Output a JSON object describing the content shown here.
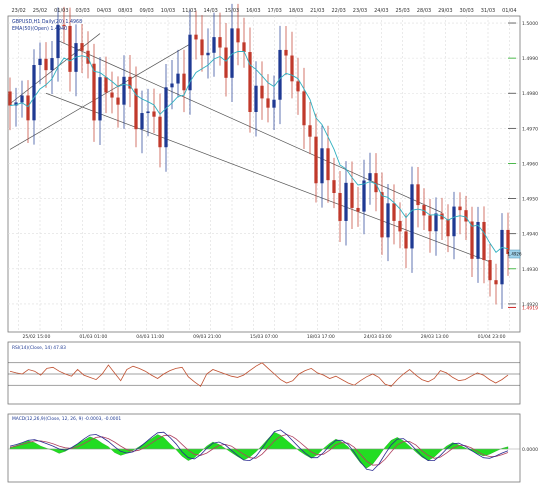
{
  "chart_data": [
    {
      "panel": "price",
      "type": "candlestick",
      "legend": [
        "GBPUSD,H1 Daily(20) 1.4968",
        "EMA(50)(Open) 1.4940"
      ],
      "top_dates": [
        "23/02",
        "25/02",
        "01/03",
        "03/03",
        "04/03",
        "08/03",
        "09/03",
        "10/03",
        "11/03",
        "14/03",
        "15/03",
        "16/03",
        "17/03",
        "18/03",
        "21/03",
        "22/03",
        "23/03",
        "24/03",
        "25/03",
        "28/03",
        "29/03",
        "30/03",
        "31/03",
        "01/04"
      ],
      "bottom_dates": [
        "25/02 15:00",
        "01/03 01:00",
        "04/03 11:00",
        "09/03 21:00",
        "15/03 07:00",
        "18/03 17:00",
        "24/03 03:00",
        "29/03 13:00",
        "01/04 23:00"
      ],
      "y_ticks": [
        1.5,
        1.499,
        1.498,
        1.497,
        1.496,
        1.495,
        1.494,
        1.493,
        1.492
      ],
      "ylim": [
        1.4912,
        1.5002
      ],
      "last_price_label": "1.4926",
      "marker_label": "1.4919",
      "series_path": [
        [
          0,
          1.4973
        ],
        [
          3,
          1.498
        ],
        [
          6,
          1.499
        ],
        [
          8,
          1.4996
        ],
        [
          10,
          1.4994
        ],
        [
          12,
          1.499
        ],
        [
          14,
          1.4981
        ],
        [
          16,
          1.4978
        ],
        [
          18,
          1.4982
        ],
        [
          20,
          1.4978
        ],
        [
          22,
          1.4974
        ],
        [
          24,
          1.497
        ],
        [
          26,
          1.4977
        ],
        [
          28,
          1.4985
        ],
        [
          30,
          1.4991
        ],
        [
          32,
          1.4995
        ],
        [
          34,
          1.4992
        ],
        [
          35,
          1.499
        ],
        [
          37,
          1.4995
        ],
        [
          39,
          1.499
        ],
        [
          41,
          1.4976
        ],
        [
          43,
          1.4978
        ],
        [
          45,
          1.4987
        ],
        [
          47,
          1.499
        ],
        [
          49,
          1.4968
        ],
        [
          51,
          1.4963
        ],
        [
          53,
          1.4954
        ],
        [
          55,
          1.495
        ],
        [
          57,
          1.4946
        ],
        [
          59,
          1.4956
        ],
        [
          61,
          1.495
        ],
        [
          63,
          1.4944
        ],
        [
          65,
          1.494
        ],
        [
          67,
          1.4947
        ],
        [
          69,
          1.4948
        ],
        [
          71,
          1.494
        ],
        [
          73,
          1.4946
        ],
        [
          75,
          1.4944
        ],
        [
          77,
          1.4941
        ],
        [
          79,
          1.4932
        ],
        [
          80,
          1.4928
        ],
        [
          82,
          1.4934
        ]
      ],
      "band_upper": [
        [
          0,
          1.4977
        ],
        [
          15,
          1.4997
        ]
      ],
      "channel_upper": [
        [
          8,
          1.4995
        ],
        [
          72,
          1.4946
        ]
      ],
      "channel_lower": [
        [
          0,
          1.4964
        ],
        [
          30,
          1.4994
        ]
      ],
      "channel_diag": [
        [
          6,
          1.498
        ],
        [
          80,
          1.4932
        ]
      ]
    },
    {
      "panel": "rsi",
      "type": "line",
      "legend": "RSI(14)(Close, 14) 47.83",
      "levels": [
        70,
        50,
        30
      ],
      "ylim": [
        0,
        100
      ],
      "values": [
        55,
        52,
        50,
        58,
        55,
        48,
        60,
        62,
        55,
        50,
        46,
        58,
        48,
        44,
        40,
        50,
        66,
        52,
        38,
        58,
        64,
        60,
        55,
        48,
        42,
        50,
        56,
        60,
        62,
        45,
        36,
        28,
        50,
        58,
        54,
        50,
        46,
        44,
        48,
        56,
        64,
        70,
        60,
        50,
        40,
        34,
        38,
        50,
        56,
        60,
        52,
        48,
        42,
        46,
        40,
        34,
        30,
        38,
        45,
        50,
        44,
        32,
        28,
        40,
        50,
        58,
        48,
        40,
        36,
        42,
        56,
        52,
        44,
        38,
        40,
        46,
        52,
        48,
        40,
        34,
        40,
        48
      ]
    },
    {
      "panel": "macd",
      "type": "histogram_line",
      "legend": "MACD(12,26,9)(Close, 12, 26, 9) -0.0003, -0.0001",
      "y_tick": "0.0000",
      "ylim": [
        -1,
        1
      ],
      "hist": [
        0.05,
        0.12,
        0.2,
        0.28,
        0.22,
        0.1,
        0.02,
        -0.05,
        -0.15,
        -0.08,
        0.04,
        0.18,
        0.3,
        0.42,
        0.34,
        0.2,
        0.08,
        -0.12,
        -0.22,
        -0.15,
        -0.05,
        0.08,
        0.22,
        0.36,
        0.5,
        0.4,
        0.18,
        -0.02,
        -0.25,
        -0.4,
        -0.3,
        -0.1,
        0.1,
        0.24,
        0.16,
        0.02,
        -0.12,
        -0.26,
        -0.38,
        -0.28,
        -0.1,
        0.12,
        0.36,
        0.58,
        0.48,
        0.3,
        0.12,
        -0.06,
        -0.2,
        -0.32,
        -0.2,
        0.02,
        0.2,
        0.34,
        0.24,
        0.08,
        -0.2,
        -0.48,
        -0.66,
        -0.52,
        -0.24,
        0.06,
        0.3,
        0.4,
        0.28,
        0.1,
        -0.1,
        -0.28,
        -0.4,
        -0.28,
        -0.08,
        0.1,
        0.22,
        0.14,
        0.04,
        -0.06,
        -0.16,
        -0.24,
        -0.18,
        -0.08,
        0.02,
        0.08
      ],
      "macd": [
        0.1,
        0.15,
        0.22,
        0.3,
        0.32,
        0.26,
        0.18,
        0.1,
        0.0,
        -0.04,
        0.05,
        0.18,
        0.34,
        0.48,
        0.5,
        0.4,
        0.26,
        0.08,
        -0.08,
        -0.14,
        -0.1,
        0.04,
        0.22,
        0.4,
        0.56,
        0.58,
        0.4,
        0.18,
        -0.1,
        -0.3,
        -0.34,
        -0.2,
        0.02,
        0.2,
        0.24,
        0.14,
        -0.04,
        -0.22,
        -0.38,
        -0.4,
        -0.26,
        0.02,
        0.32,
        0.6,
        0.66,
        0.5,
        0.28,
        0.06,
        -0.14,
        -0.3,
        -0.3,
        -0.12,
        0.12,
        0.3,
        0.3,
        0.16,
        -0.12,
        -0.44,
        -0.7,
        -0.74,
        -0.52,
        -0.18,
        0.14,
        0.34,
        0.36,
        0.2,
        -0.02,
        -0.24,
        -0.4,
        -0.4,
        -0.22,
        0.0,
        0.18,
        0.2,
        0.1,
        -0.04,
        -0.18,
        -0.3,
        -0.32,
        -0.24,
        -0.14,
        -0.06
      ],
      "signal": [
        0.06,
        0.1,
        0.16,
        0.22,
        0.28,
        0.28,
        0.24,
        0.18,
        0.1,
        0.04,
        0.02,
        0.08,
        0.18,
        0.3,
        0.4,
        0.42,
        0.36,
        0.24,
        0.1,
        -0.02,
        -0.08,
        -0.04,
        0.06,
        0.2,
        0.34,
        0.46,
        0.48,
        0.36,
        0.16,
        -0.04,
        -0.18,
        -0.22,
        -0.14,
        0.0,
        0.12,
        0.16,
        0.1,
        -0.04,
        -0.18,
        -0.3,
        -0.32,
        -0.18,
        0.04,
        0.28,
        0.44,
        0.5,
        0.42,
        0.26,
        0.08,
        -0.1,
        -0.2,
        -0.18,
        -0.04,
        0.14,
        0.22,
        0.2,
        0.06,
        -0.18,
        -0.42,
        -0.56,
        -0.54,
        -0.36,
        -0.1,
        0.14,
        0.26,
        0.26,
        0.14,
        -0.06,
        -0.22,
        -0.32,
        -0.28,
        -0.14,
        0.02,
        0.12,
        0.12,
        0.04,
        -0.08,
        -0.2,
        -0.26,
        -0.26,
        -0.2,
        -0.12
      ]
    }
  ],
  "colors": {
    "up": "#1f3a93",
    "down": "#c0392b",
    "ema": "#30b0c0",
    "rsi": "#c05030",
    "hist": "#22dd22",
    "macd": "#2a2a90",
    "signal": "#b04060",
    "green_tick": "#22aa22",
    "red_tick": "#cc2222"
  }
}
